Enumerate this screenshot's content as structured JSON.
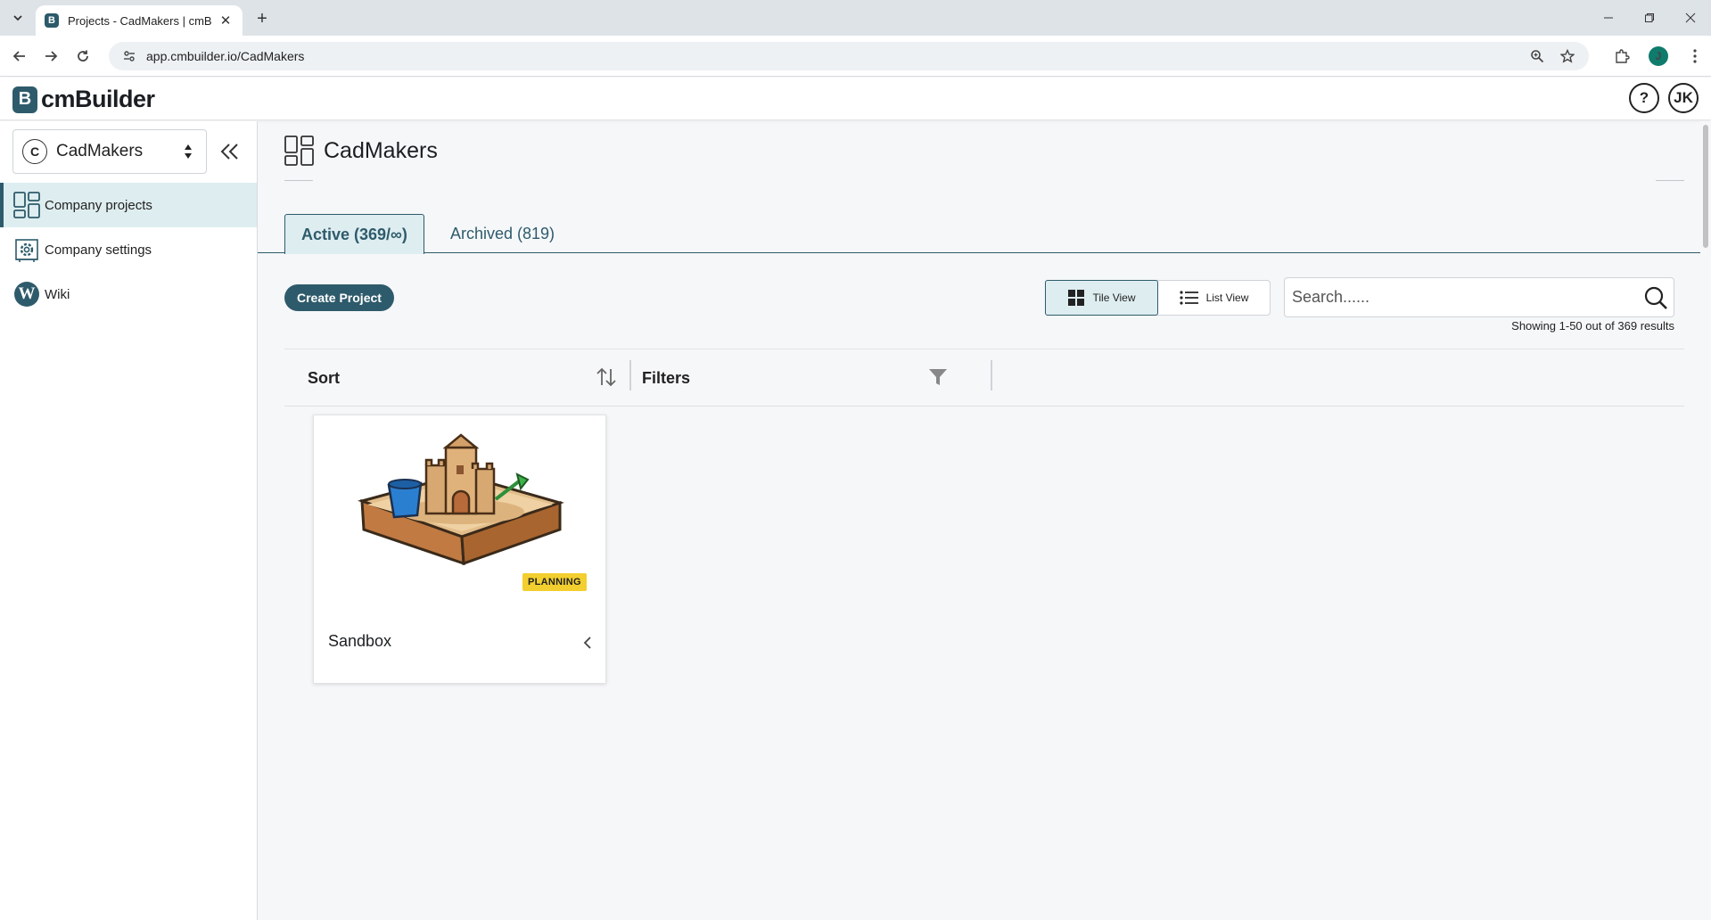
{
  "browser": {
    "tab_title": "Projects - CadMakers | cmBuilder",
    "favicon_letter": "B",
    "url": "app.cmbuilder.io/CadMakers",
    "profile_initial": "J",
    "tab_close_glyph": "✕",
    "new_tab_glyph": "+"
  },
  "header": {
    "logo_letter": "B",
    "logo_text": "cmBuilder",
    "help_glyph": "?",
    "user_initials": "JK"
  },
  "sidebar": {
    "company_initial": "C",
    "company_name": "CadMakers",
    "items": [
      {
        "label": "Company projects",
        "icon": "projects-grid-icon",
        "active": true
      },
      {
        "label": "Company settings",
        "icon": "settings-gear-icon",
        "active": false
      },
      {
        "label": "Wiki",
        "icon": "wiki-icon",
        "icon_letter": "W",
        "active": false
      }
    ]
  },
  "main": {
    "page_title": "CadMakers",
    "tabs": [
      {
        "label": "Active (369/∞)",
        "active": true
      },
      {
        "label": "Archived (819)",
        "active": false
      }
    ],
    "create_button": "Create Project",
    "views": [
      {
        "label": "Tile View",
        "active": true
      },
      {
        "label": "List View",
        "active": false
      }
    ],
    "search": {
      "placeholder": "Search......",
      "value": ""
    },
    "results_text": "Showing 1-50 out of 369 results",
    "sort_label": "Sort",
    "filters_label": "Filters",
    "projects": [
      {
        "name": "Sandbox",
        "status": "PLANNING",
        "image": "sandbox-castle-image"
      }
    ]
  },
  "colors": {
    "accent": "#2e5b6b",
    "active_bg": "#deedf0",
    "status_planning": "#f2cf2f"
  }
}
